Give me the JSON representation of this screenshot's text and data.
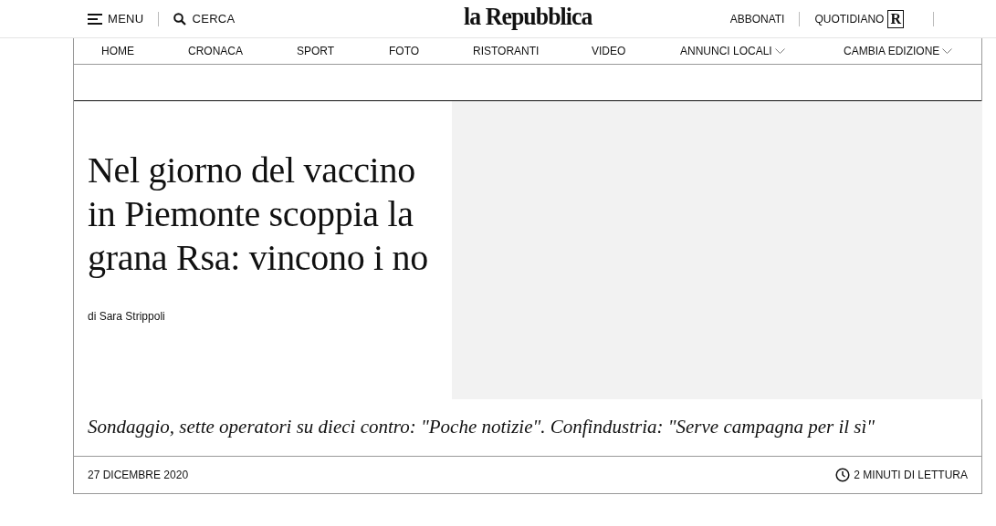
{
  "header": {
    "menu": "MENU",
    "search": "CERCA",
    "logo": "la Repubblica",
    "subscribe": "ABBONATI",
    "newspaper": "QUOTIDIANO",
    "newspaper_badge": "R"
  },
  "nav": [
    {
      "label": "HOME",
      "kind": "link"
    },
    {
      "label": "CRONACA",
      "kind": "link"
    },
    {
      "label": "SPORT",
      "kind": "link"
    },
    {
      "label": "FOTO",
      "kind": "link"
    },
    {
      "label": "RISTORANTI",
      "kind": "link"
    },
    {
      "label": "VIDEO",
      "kind": "link"
    },
    {
      "label": "ANNUNCI LOCALI",
      "kind": "dropdown"
    },
    {
      "label": "CAMBIA EDIZIONE",
      "kind": "dropdown"
    }
  ],
  "article": {
    "title": "Nel giorno del vaccino in Piemonte scoppia la grana Rsa: vincono i no",
    "author": "di Sara Strippoli",
    "image": {
      "kind": "placeholder"
    },
    "subtitle": "Sondaggio, sette operatori su dieci contro: \"Poche notizie\". Confindustria: \"Serve campagna per il sì\"",
    "date": "27 DICEMBRE 2020",
    "reading_time": "2 MINUTI DI LETTURA"
  }
}
